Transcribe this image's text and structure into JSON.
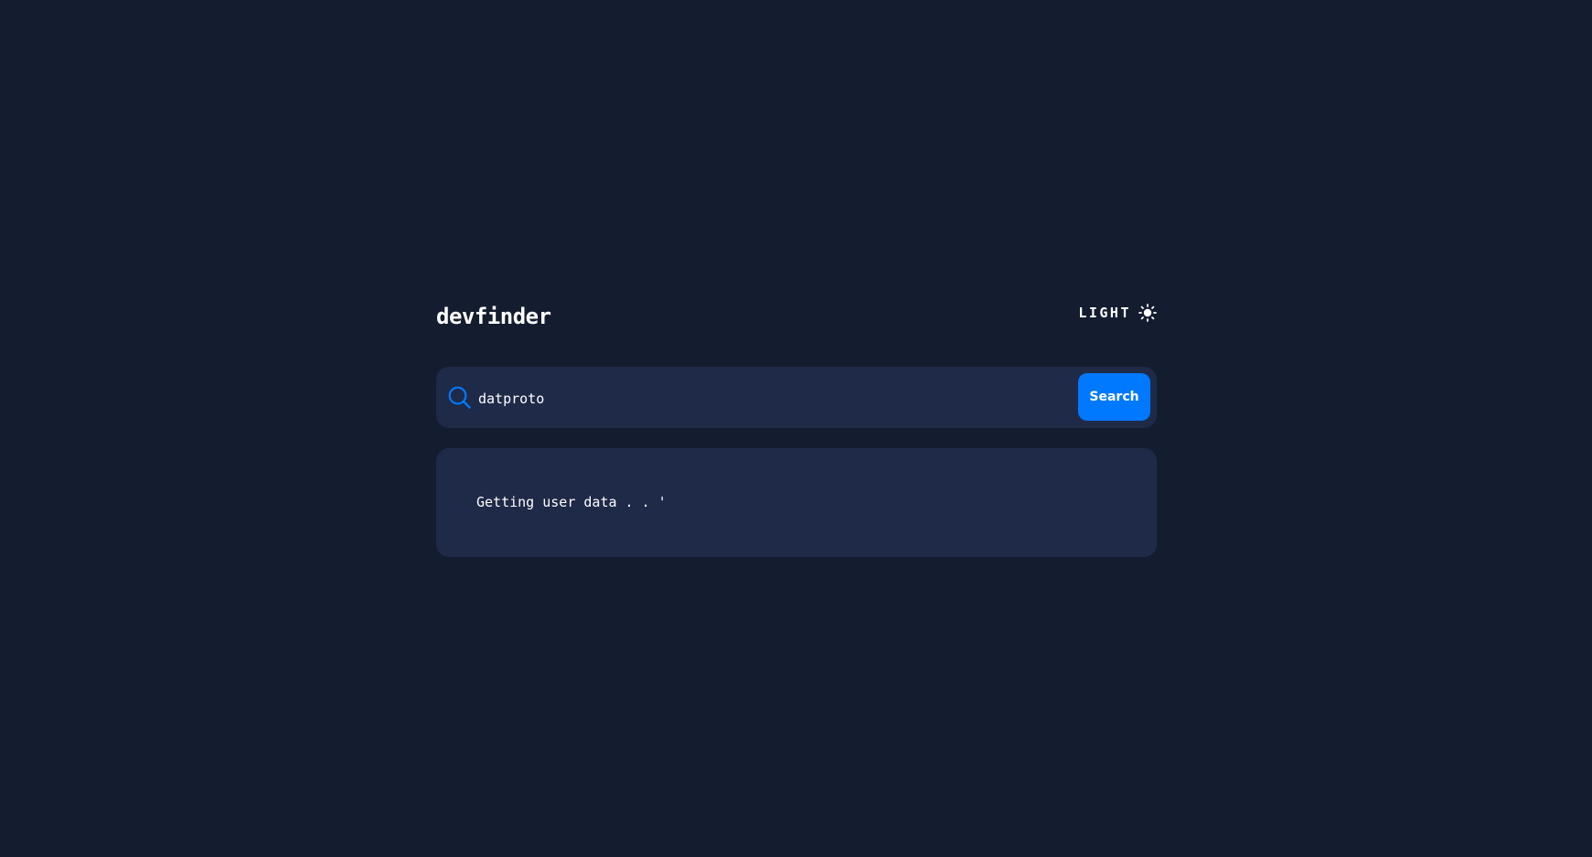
{
  "app": {
    "title": "devfinder"
  },
  "theme_toggle": {
    "label": "LIGHT",
    "icon": "sun-icon"
  },
  "search": {
    "value": "datproto",
    "placeholder": "",
    "icon": "search-icon",
    "button_label": "Search"
  },
  "result": {
    "status_text": "Getting user data . . '"
  },
  "colors": {
    "background": "#141c2f",
    "card": "#1f2a48",
    "accent": "#0079ff",
    "text": "#ffffff"
  }
}
